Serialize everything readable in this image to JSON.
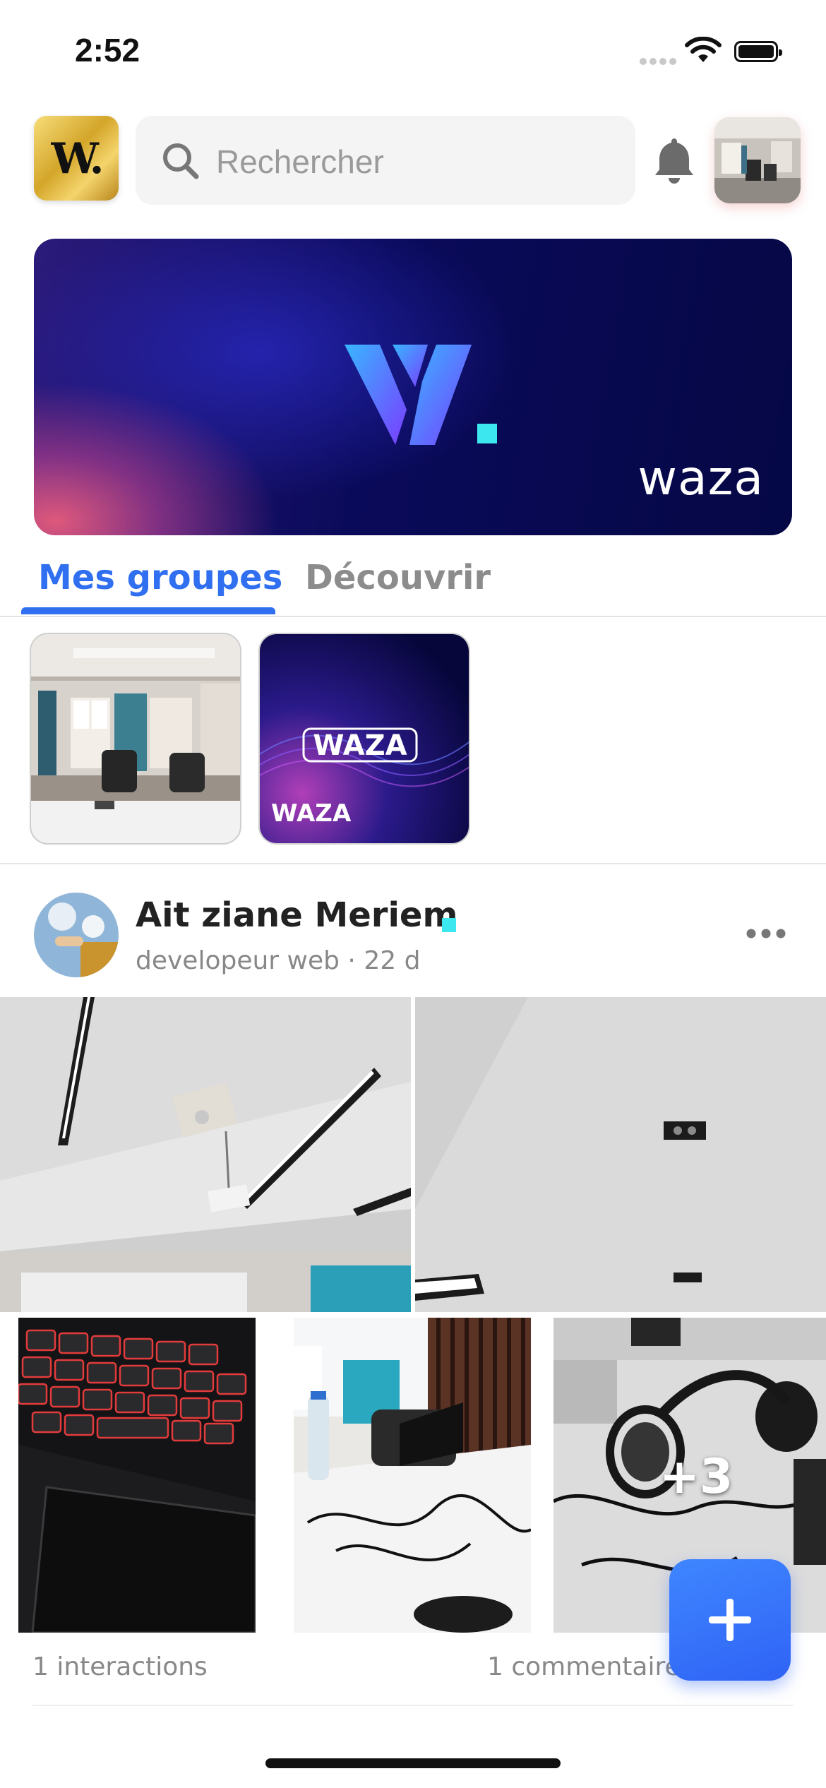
{
  "status_bar": {
    "time": "2:52"
  },
  "header": {
    "logo_letter": "W.",
    "search_placeholder": "Rechercher",
    "icons": [
      "search-icon",
      "bell-icon"
    ]
  },
  "banner": {
    "brand": "waza"
  },
  "tabs": [
    {
      "label": "Mes groupes",
      "active": true
    },
    {
      "label": "Découvrir",
      "active": false
    }
  ],
  "groups": [
    {
      "name": ""
    },
    {
      "name": "WAZA"
    }
  ],
  "post": {
    "author": "Ait ziane Meriem",
    "meta": "developeur web · 22 d",
    "more_photos": "+3",
    "interactions": "1 interactions",
    "comments": "1 commentaires"
  },
  "colors": {
    "accent": "#2f6ff0",
    "fab": "#3a78ff",
    "online": "#3de7f0"
  }
}
